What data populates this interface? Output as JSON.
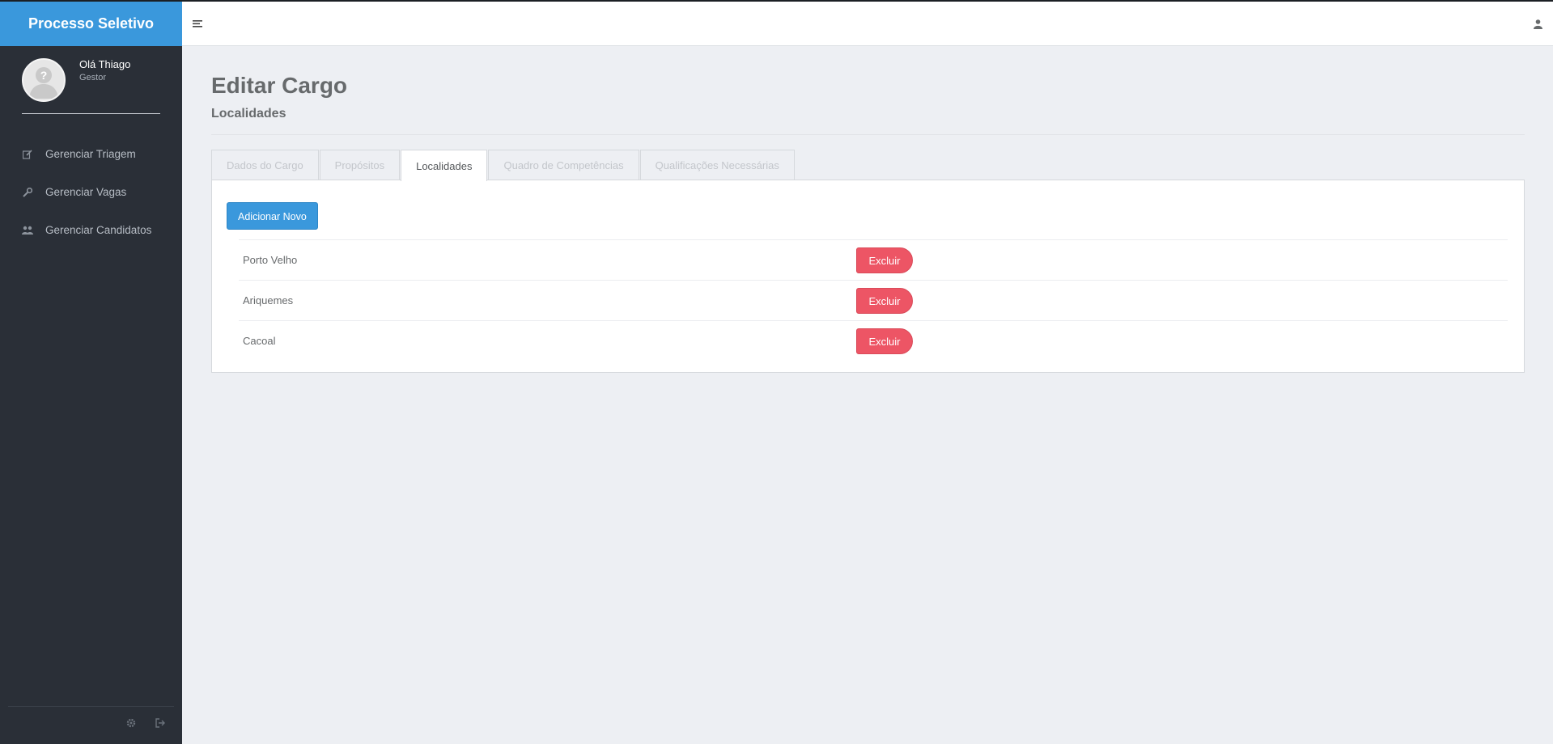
{
  "app": {
    "brand": "Processo Seletivo"
  },
  "user": {
    "greeting": "Olá Thiago",
    "role": "Gestor"
  },
  "sidebar": {
    "items": [
      {
        "label": "Gerenciar Triagem",
        "icon": "edit-icon"
      },
      {
        "label": "Gerenciar Vagas",
        "icon": "wrench-icon"
      },
      {
        "label": "Gerenciar Candidatos",
        "icon": "users-icon"
      }
    ],
    "footer_icons": [
      "gear-icon",
      "logout-icon"
    ]
  },
  "page": {
    "title": "Editar Cargo",
    "subtitle": "Localidades"
  },
  "tabs": [
    {
      "label": "Dados do Cargo",
      "active": false
    },
    {
      "label": "Propósitos",
      "active": false
    },
    {
      "label": "Localidades",
      "active": true
    },
    {
      "label": "Quadro de Competências",
      "active": false
    },
    {
      "label": "Qualificações Necessárias",
      "active": false
    }
  ],
  "panel": {
    "add_label": "Adicionar Novo",
    "rows": [
      {
        "name": "Porto Velho",
        "action": "Excluir"
      },
      {
        "name": "Ariquemes",
        "action": "Excluir"
      },
      {
        "name": "Cacoal",
        "action": "Excluir"
      }
    ]
  },
  "colors": {
    "brand": "#3a98dc",
    "sidebar": "#2a2f37",
    "danger": "#ed5565"
  }
}
